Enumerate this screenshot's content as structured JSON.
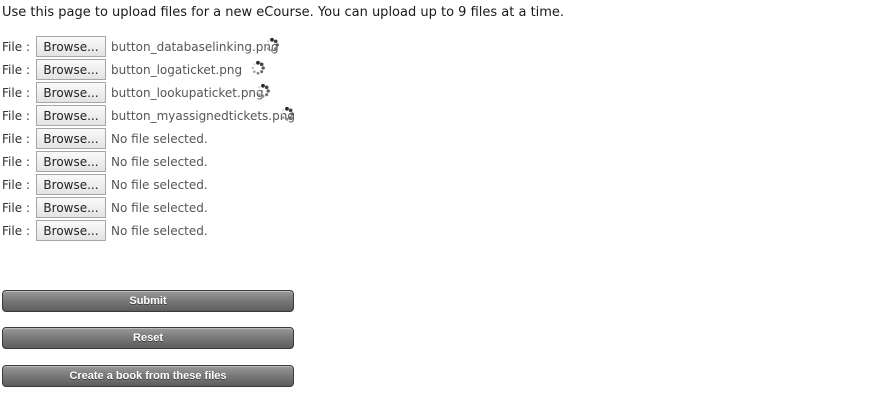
{
  "intro_text": "Use this page to upload files for a new eCourse. You can upload up to 9 files at a time.",
  "file_label": "File :",
  "browse_label": "Browse...",
  "files": [
    {
      "name": "button_databaselinking.png",
      "uploading": true
    },
    {
      "name": "button_logaticket.png",
      "uploading": true
    },
    {
      "name": "button_lookupaticket.png",
      "uploading": true
    },
    {
      "name": "button_myassignedtickets.png",
      "uploading": true
    },
    {
      "name": "No file selected.",
      "uploading": false
    },
    {
      "name": "No file selected.",
      "uploading": false
    },
    {
      "name": "No file selected.",
      "uploading": false
    },
    {
      "name": "No file selected.",
      "uploading": false
    },
    {
      "name": "No file selected.",
      "uploading": false
    }
  ],
  "buttons": {
    "submit": "Submit",
    "reset": "Reset",
    "create_book": "Create a book from these files"
  },
  "icons": {
    "spinner": "loading-spinner-icon"
  }
}
